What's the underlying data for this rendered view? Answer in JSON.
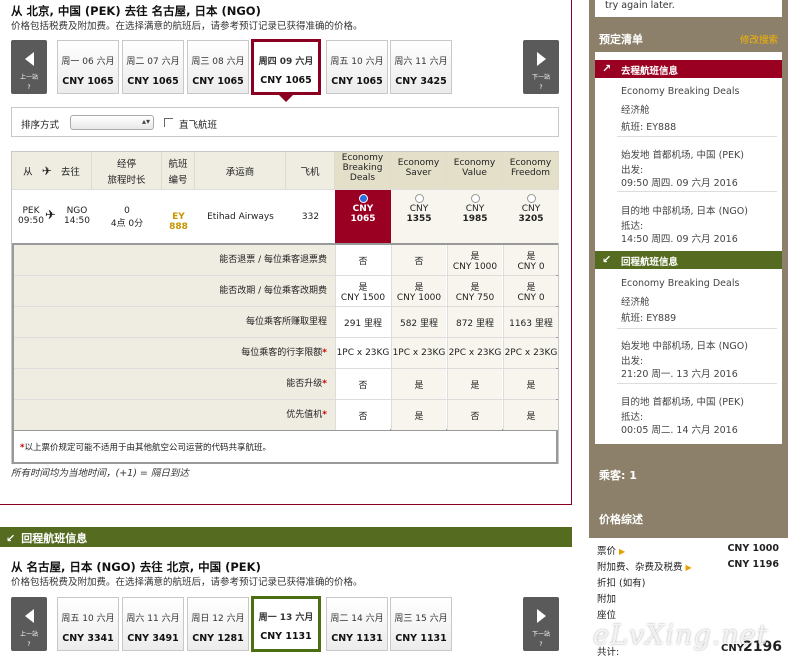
{
  "outbound": {
    "route": "从 北京, 中国 (PEK) 去往 名古屋, 日本 (NGO)",
    "subtitle": "价格包括税费及附加费。在选择满意的航班后，请参考预订记录已获得准确的价格。",
    "prev_label": "上一站",
    "next_label": "下一站",
    "nav_q": "?",
    "dates": [
      {
        "day": "周一 06 六月",
        "price": "CNY 1065"
      },
      {
        "day": "周二 07 六月",
        "price": "CNY 1065"
      },
      {
        "day": "周三 08 六月",
        "price": "CNY 1065"
      },
      {
        "day": "周四 09 六月",
        "price": "CNY 1065"
      },
      {
        "day": "周五 10 六月",
        "price": "CNY 1065"
      },
      {
        "day": "周六 11 六月",
        "price": "CNY 3425"
      }
    ]
  },
  "sort": {
    "label": "排序方式",
    "value": "",
    "direct_label": "直飞航班"
  },
  "table": {
    "headers": {
      "from": "从",
      "to": "去往",
      "stops": "经停",
      "duration": "旅程时长",
      "flightno_a": "航班",
      "flightno_b": "编号",
      "carrier": "承运商",
      "aircraft": "飞机",
      "fares": [
        {
          "a": "Economy",
          "b": "Breaking",
          "c": "Deals"
        },
        {
          "a": "Economy",
          "b": "Saver",
          "c": ""
        },
        {
          "a": "Economy",
          "b": "Value",
          "c": ""
        },
        {
          "a": "Economy",
          "b": "Freedom",
          "c": ""
        }
      ]
    },
    "flight": {
      "dep_code": "PEK",
      "dep_time": "09:50",
      "arr_code": "NGO",
      "arr_time": "14:50",
      "stops": "0",
      "duration": "4点 0分",
      "number": "EY 888",
      "carrier": "Etihad Airways",
      "aircraft": "332",
      "fares": [
        {
          "cur": "CNY",
          "amt": "1065"
        },
        {
          "cur": "CNY",
          "amt": "1355"
        },
        {
          "cur": "CNY",
          "amt": "1985"
        },
        {
          "cur": "CNY",
          "amt": "3205"
        }
      ]
    },
    "details": [
      {
        "label": "能否退票 / 每位乘客退票费",
        "star": "",
        "cells": [
          [
            "否",
            ""
          ],
          [
            "否",
            ""
          ],
          [
            "是",
            "CNY 1000"
          ],
          [
            "是",
            "CNY 0"
          ]
        ]
      },
      {
        "label": "能否改期 / 每位乘客改期费",
        "star": "",
        "cells": [
          [
            "是",
            "CNY 1500"
          ],
          [
            "是",
            "CNY 1000"
          ],
          [
            "是",
            "CNY 750"
          ],
          [
            "是",
            "CNY 0"
          ]
        ]
      },
      {
        "label": "每位乘客所赚取里程",
        "star": "",
        "cells": [
          [
            "291 里程",
            ""
          ],
          [
            "582 里程",
            ""
          ],
          [
            "872 里程",
            ""
          ],
          [
            "1163 里程",
            ""
          ]
        ]
      },
      {
        "label": "每位乘客的行李限额",
        "star": "*",
        "cells": [
          [
            "1PC x 23KG",
            ""
          ],
          [
            "1PC x 23KG",
            ""
          ],
          [
            "2PC x 23KG",
            ""
          ],
          [
            "2PC x 23KG",
            ""
          ]
        ]
      },
      {
        "label": "能否升级",
        "star": "*",
        "cells": [
          [
            "否",
            ""
          ],
          [
            "是",
            ""
          ],
          [
            "是",
            ""
          ],
          [
            "是",
            ""
          ]
        ]
      },
      {
        "label": "优先值机",
        "star": "*",
        "cells": [
          [
            "否",
            ""
          ],
          [
            "是",
            ""
          ],
          [
            "否",
            ""
          ],
          [
            "是",
            ""
          ]
        ]
      }
    ],
    "footnote": "以上票价规定可能不适用于由其他航空公司运营的代码共享航班。",
    "footnote_star": "*"
  },
  "local_time_note": "所有时间均为当地时间，(+1) = 隔日到达",
  "return": {
    "bar_label": "回程航班信息",
    "route": "从 名古屋, 日本 (NGO) 去往 北京, 中国 (PEK)",
    "subtitle": "价格包括税费及附加费。在选择满意的航班后，请参考预订记录已获得准确的价格。",
    "dates": [
      {
        "day": "周五 10 六月",
        "price": "CNY 3341"
      },
      {
        "day": "周六 11 六月",
        "price": "CNY 3491"
      },
      {
        "day": "周日 12 六月",
        "price": "CNY 1281"
      },
      {
        "day": "周一 13 六月",
        "price": "CNY 1131"
      },
      {
        "day": "周二 14 六月",
        "price": "CNY 1131"
      },
      {
        "day": "周三 15 六月",
        "price": "CNY 1131"
      }
    ]
  },
  "sidebar": {
    "top_note": "try again later.",
    "itinerary_title": "预定清单",
    "edit_search": "修改搜索",
    "outbound_bar": "去程航班信息",
    "return_bar": "回程航班信息",
    "out": {
      "fare": "Economy Breaking Deals",
      "cabin": "经济舱",
      "flight": "航班:   EY888",
      "origin": "始发地 首都机场, 中国 (PEK)",
      "dep_label": "出发:",
      "dep": "09:50 周四. 09 六月 2016",
      "dest": "目的地 中部机场, 日本 (NGO)",
      "arr_label": "抵达:",
      "arr": "14:50 周四. 09 六月 2016"
    },
    "ret": {
      "fare": "Economy Breaking Deals",
      "cabin": "经济舱",
      "flight": "航班:   EY889",
      "origin": "始发地 中部机场, 日本 (NGO)",
      "dep_label": "出发:",
      "dep": "21:20 周一. 13 六月 2016",
      "dest": "目的地 首都机场, 中国 (PEK)",
      "arr_label": "抵达:",
      "arr": "00:05 周二. 14 六月 2016"
    },
    "passengers": "乘客: 1",
    "price_title": "价格综述",
    "price_rows": [
      {
        "label": "票价",
        "value": "CNY 1000"
      },
      {
        "label": "附加费、杂费及税费",
        "value": "CNY 1196"
      },
      {
        "label": "折扣 (如有)",
        "value": ""
      },
      {
        "label": "附加",
        "value": ""
      },
      {
        "label": "座位",
        "value": ""
      }
    ],
    "total_label": "共计:",
    "total_cur": "CNY",
    "total_amt": "2196"
  },
  "watermark": "eLvXing.net",
  "colors": {
    "outbound": "#8b0021",
    "return": "#556b1f",
    "sidebar": "#8c806a",
    "accent": "#f4b400"
  }
}
